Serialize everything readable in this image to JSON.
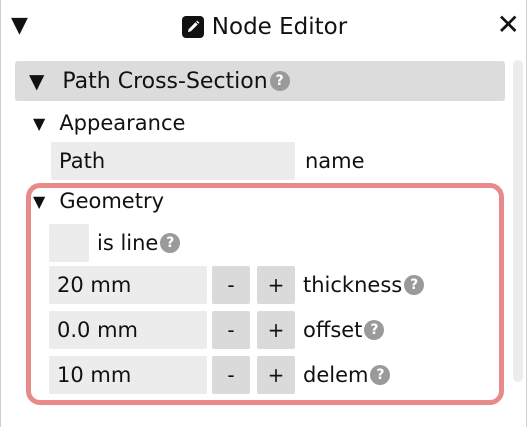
{
  "window": {
    "title": "Node Editor",
    "collapse_glyph": "▼",
    "close_glyph": "✕"
  },
  "section": {
    "label": "Path Cross-Section",
    "collapse_glyph": "▼",
    "help_glyph": "?"
  },
  "appearance": {
    "label": "Appearance",
    "collapse_glyph": "▼",
    "name_value": "Path",
    "name_label": "name"
  },
  "geometry": {
    "label": "Geometry",
    "collapse_glyph": "▼",
    "is_line_label": "is line",
    "help_glyph": "?",
    "minus_label": "-",
    "plus_label": "+",
    "params": {
      "thickness": {
        "value": "20 mm",
        "label": "thickness"
      },
      "offset": {
        "value": "0.0 mm",
        "label": "offset"
      },
      "delem": {
        "value": "10 mm",
        "label": "delem"
      }
    }
  },
  "colors": {
    "highlight": "#e88a8a",
    "section_bg": "#dcdcdc",
    "field_bg": "#ececec",
    "help_bg": "#9a9a9a"
  },
  "icons": {
    "title": "pencil-icon",
    "close": "close-icon",
    "help": "help-icon"
  }
}
